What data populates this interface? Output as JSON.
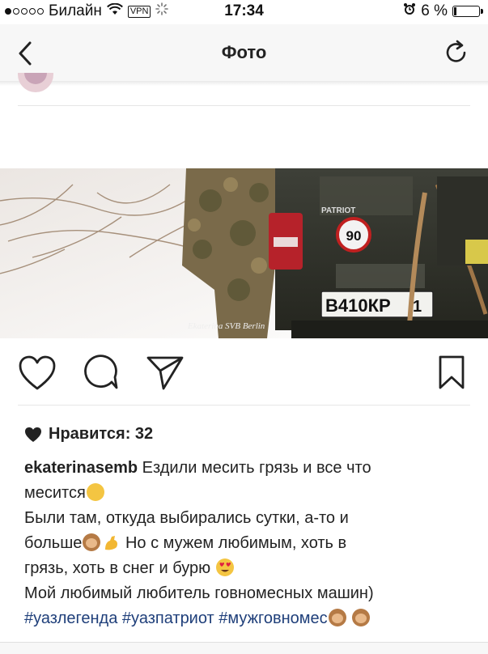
{
  "status": {
    "carrier": "Билайн",
    "vpn": "VPN",
    "time": "17:34",
    "battery": "6 %",
    "signal_bars_filled": 1,
    "signal_bars_total": 5
  },
  "navbar": {
    "title": "Фото",
    "back_icon": "chevron-left-icon",
    "refresh_icon": "refresh-icon"
  },
  "photo": {
    "watermark": "Ekaterina SVB Berlin",
    "plate": "В410КР",
    "plate_region": "1",
    "speed_sign": "90",
    "brand": "PATRIOT"
  },
  "actions": {
    "like_icon": "heart-icon",
    "comment_icon": "comment-icon",
    "share_icon": "send-icon",
    "bookmark_icon": "bookmark-icon"
  },
  "likes": {
    "label": "Нравится: 32"
  },
  "caption": {
    "username": "ekaterinasemb",
    "line1": " Ездили месить грязь и все что",
    "line2": "месится",
    "line3": "Были там, откуда выбирались сутки, а-то и",
    "line4a": "больше",
    "line4b": "  Но с мужем любимым, хоть в",
    "line5": "грязь, хоть в снег и бурю ",
    "line6": "Мой любимый любитель говномесных машин)",
    "hashtag1": "#уазлегенда",
    "hashtag2": "#уазпатриот",
    "hashtag3": "#мужговномес"
  },
  "colors": {
    "hashtag": "#1f3f7a",
    "navbar_bg": "#f7f7f7"
  }
}
